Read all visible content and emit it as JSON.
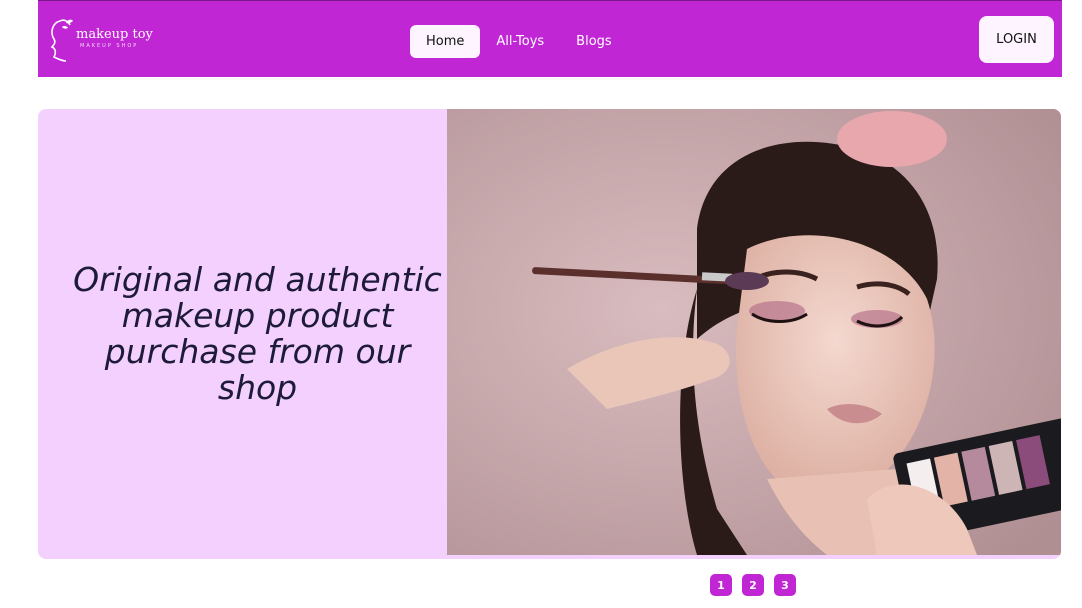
{
  "brand": {
    "name": "makeup toy",
    "tagline": "MAKEUP SHOP",
    "color": "#c026d3"
  },
  "nav": {
    "items": [
      {
        "label": "Home",
        "active": true
      },
      {
        "label": "All-Toys",
        "active": false
      },
      {
        "label": "Blogs",
        "active": false
      }
    ],
    "login_label": "LOGIN"
  },
  "hero": {
    "title": "Original and authentic makeup product purchase from our shop",
    "panel_color": "#f3d0fd"
  },
  "pager": {
    "pages": [
      "1",
      "2",
      "3"
    ]
  }
}
